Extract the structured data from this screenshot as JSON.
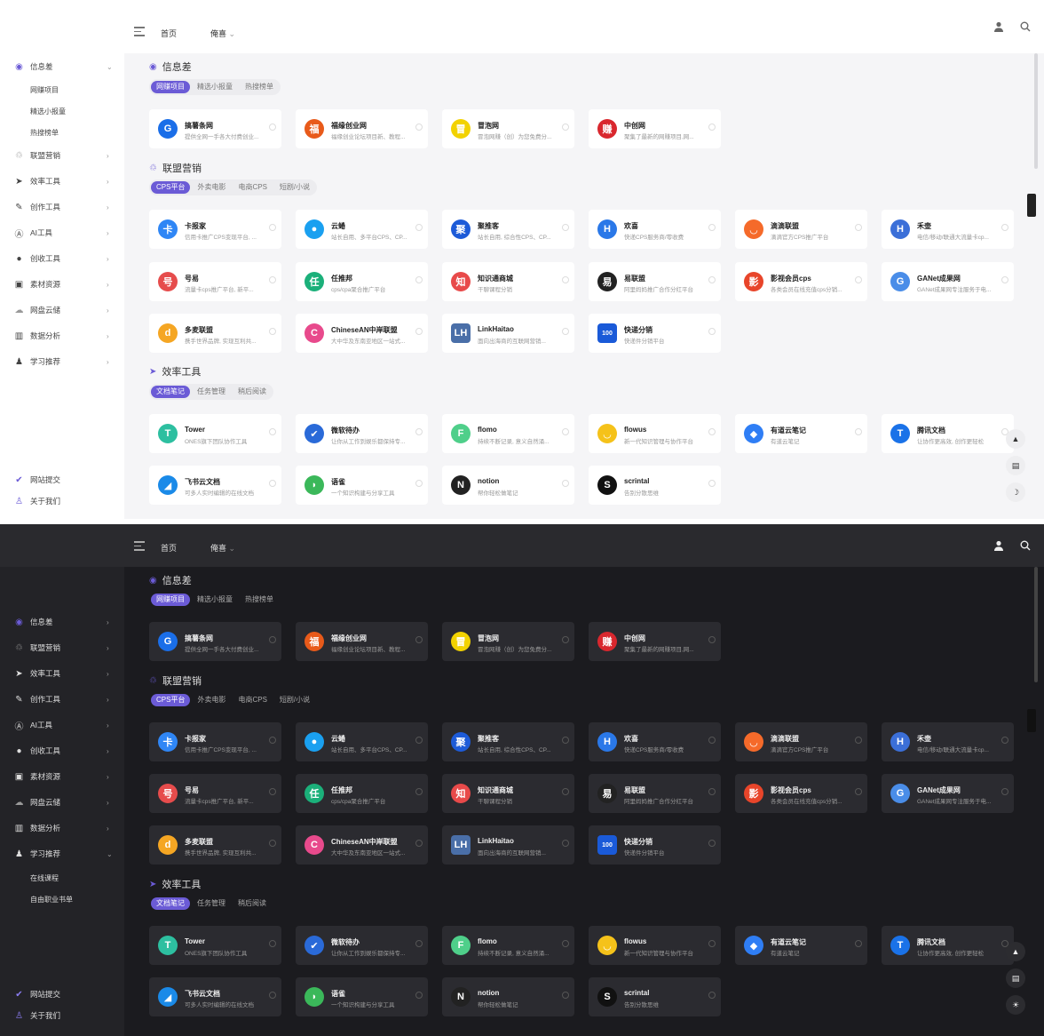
{
  "nav": {
    "home": "首页",
    "about": "俺喜",
    "about_caret": "⌄"
  },
  "sidebar": {
    "items": [
      {
        "label": "信息差",
        "icon": "pin-icon",
        "glyph": "◉",
        "color": "#6b5bd6"
      },
      {
        "label": "联盟营销",
        "icon": "recycle-icon",
        "glyph": "♲",
        "color": "#999"
      },
      {
        "label": "效率工具",
        "icon": "send-icon",
        "glyph": "➤",
        "color": "#444"
      },
      {
        "label": "创作工具",
        "icon": "pen-icon",
        "glyph": "✎",
        "color": "#444"
      },
      {
        "label": "AI工具",
        "icon": "ai-icon",
        "glyph": "Ⓐ",
        "color": "#444"
      },
      {
        "label": "创收工具",
        "icon": "bottle-icon",
        "glyph": "●",
        "color": "#444"
      },
      {
        "label": "素材资源",
        "icon": "image-icon",
        "glyph": "▣",
        "color": "#444"
      },
      {
        "label": "网盘云储",
        "icon": "cloud-icon",
        "glyph": "☁",
        "color": "#999"
      },
      {
        "label": "数据分析",
        "icon": "chart-icon",
        "glyph": "▥",
        "color": "#444"
      },
      {
        "label": "学习推荐",
        "icon": "user-group-icon",
        "glyph": "♟",
        "color": "#444"
      }
    ],
    "sub_light": [
      "网赚项目",
      "精选小报童",
      "热搜榜单"
    ],
    "sub_dark": [
      "在线课程",
      "自由职业书单"
    ],
    "footer": [
      {
        "label": "网站提交",
        "icon": "check-icon",
        "glyph": "✔"
      },
      {
        "label": "关于我们",
        "icon": "person-icon",
        "glyph": "👤"
      }
    ]
  },
  "sections": {
    "info": {
      "title": "信息差",
      "tabs": [
        "网赚项目",
        "精选小报童",
        "热搜榜单"
      ],
      "cards": [
        {
          "name": "搞薯条网",
          "desc": "提供全网一手各大付费创业...",
          "logo": "G",
          "color": "#1a6ee8"
        },
        {
          "name": "福缘创业网",
          "desc": "福缘创业论坛项目新、教程...",
          "logo": "福",
          "color": "#e85a1a"
        },
        {
          "name": "冒泡网",
          "desc": "冒泡网赚（创）为您免费分...",
          "logo": "冒",
          "color": "#f2d200"
        },
        {
          "name": "中创网",
          "desc": "聚集了最新的网赚项目,网...",
          "logo": "赚",
          "color": "#d9272e"
        }
      ]
    },
    "alliance": {
      "title": "联盟营销",
      "tabs": [
        "CPS平台",
        "外卖电影",
        "电商CPS",
        "短剧/小说"
      ],
      "cards": [
        {
          "name": "卡报家",
          "desc": "信用卡推广CPS变现平台, ...",
          "logo": "卡",
          "color": "#2f86f5"
        },
        {
          "name": "云蜷",
          "desc": "站长自用、多平台CPS、CP...",
          "logo": "●",
          "color": "#1aa0f0"
        },
        {
          "name": "聚推客",
          "desc": "站长自用, 综合性CPS、CP...",
          "logo": "聚",
          "color": "#1d5bd8"
        },
        {
          "name": "欢喜",
          "desc": "快递CPS服务商/零收费",
          "logo": "H",
          "color": "#2a78e8"
        },
        {
          "name": "滴滴联盟",
          "desc": "滴滴官方CPS推广平台",
          "logo": "◡",
          "color": "#f56a2a"
        },
        {
          "name": "禾壶",
          "desc": "电信/移动/联通大流量卡cp...",
          "logo": "H",
          "color": "#3b6fd8"
        },
        {
          "name": "号易",
          "desc": "流量卡cps推广平台, 新平...",
          "logo": "号",
          "color": "#e64c4c"
        },
        {
          "name": "任推邦",
          "desc": "cps/cpa聚合推广平台",
          "logo": "任",
          "color": "#1bb07a"
        },
        {
          "name": "知识通商城",
          "desc": "干聊课程分销",
          "logo": "知",
          "color": "#e84a4a"
        },
        {
          "name": "易联盟",
          "desc": "阿里妈妈推广合作分红平台",
          "logo": "易",
          "color": "#222"
        },
        {
          "name": "影视会员cps",
          "desc": "各类会员在线充值cps分销...",
          "logo": "影",
          "color": "#e8452a"
        },
        {
          "name": "GANet成果网",
          "desc": "GANet成果网专注服务于电...",
          "logo": "G",
          "color": "#4a8de8"
        },
        {
          "name": "多麦联盟",
          "desc": "携手世界品牌, 实现互利共...",
          "logo": "d",
          "color": "#f5a623"
        },
        {
          "name": "ChineseAN中岸联盟",
          "desc": "大中华及东南亚地区一站式...",
          "logo": "C",
          "color": "#e84a8c"
        },
        {
          "name": "LinkHaitao",
          "desc": "面向出海商的互联网营销...",
          "logo": "LH",
          "color": "#4a6fa8"
        },
        {
          "name": "快递分销",
          "desc": "快递件分销平台",
          "logo": "100",
          "color": "#1a5ad8"
        }
      ]
    },
    "efficiency": {
      "title": "效率工具",
      "tabs": [
        "文档笔记",
        "任务管理",
        "稍后阅读"
      ],
      "cards": [
        {
          "name": "Tower",
          "desc": "ONES旗下团队协作工具",
          "logo": "T",
          "color": "#2dbfa0"
        },
        {
          "name": "微软待办",
          "desc": "让你从工作到娱乐都保持专...",
          "logo": "✔",
          "color": "#2a6ad8"
        },
        {
          "name": "flomo",
          "desc": "持续不断记录, 意义自然涌...",
          "logo": "F",
          "color": "#4fcf8a"
        },
        {
          "name": "flowus",
          "desc": "新一代知识管理与协作平台",
          "logo": "◡",
          "color": "#f5c21a"
        },
        {
          "name": "有道云笔记",
          "desc": "有道云笔记",
          "logo": "◆",
          "color": "#2f7ef5"
        },
        {
          "name": "腾讯文档",
          "desc": "让协作更高效, 创作更轻松",
          "logo": "T",
          "color": "#1a72e8"
        },
        {
          "name": "飞书云文档",
          "desc": "可多人实时编辑的在线文档",
          "logo": "◢",
          "color": "#1a8ae8"
        },
        {
          "name": "语雀",
          "desc": "一个知识构建与分享工具",
          "logo": "◗",
          "color": "#3bb85a"
        },
        {
          "name": "notion",
          "desc": "帮你轻松做笔记",
          "logo": "N",
          "color": "#222"
        },
        {
          "name": "scrintal",
          "desc": "告别分散思维",
          "logo": "S",
          "color": "#111"
        }
      ]
    }
  },
  "floats": {
    "top": "▲",
    "mid": "▤",
    "mode_light": "☽",
    "mode_dark": "☀"
  },
  "colors": {
    "accent": "#6b5bd6"
  }
}
